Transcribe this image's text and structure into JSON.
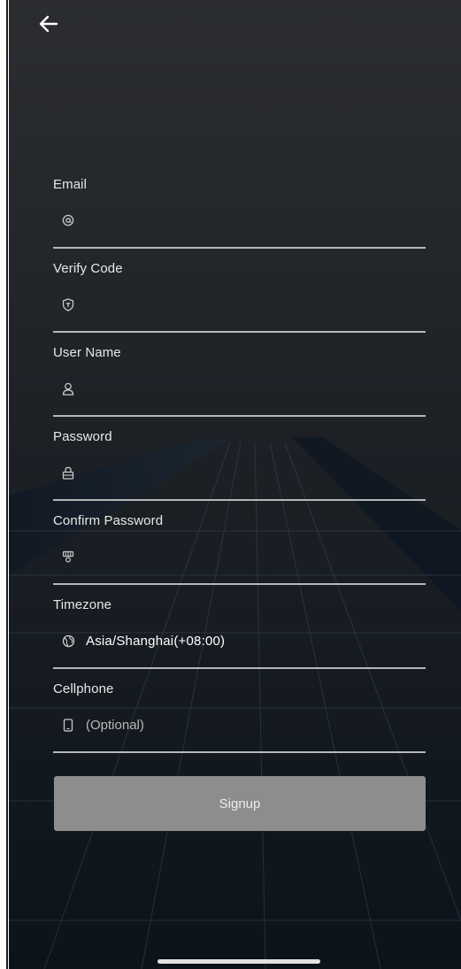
{
  "header": {
    "back_icon": "arrow-left-icon"
  },
  "form": {
    "fields": [
      {
        "label": "Email",
        "icon": "at-sign-icon",
        "value": "",
        "placeholder": ""
      },
      {
        "label": "Verify Code",
        "icon": "shield-icon",
        "value": "",
        "placeholder": ""
      },
      {
        "label": "User Name",
        "icon": "user-icon",
        "value": "",
        "placeholder": ""
      },
      {
        "label": "Password",
        "icon": "lock-icon",
        "value": "",
        "placeholder": ""
      },
      {
        "label": "Confirm Password",
        "icon": "key-icon",
        "value": "",
        "placeholder": ""
      },
      {
        "label": "Timezone",
        "icon": "globe-icon",
        "value": "Asia/Shanghai(+08:00)"
      },
      {
        "label": "Cellphone",
        "icon": "phone-icon",
        "value": "",
        "placeholder": "(Optional)"
      }
    ],
    "submit_label": "Signup"
  },
  "colors": {
    "background": "#1c1f24",
    "text": "#ffffff",
    "underline": "#b4b6b8",
    "button": "#8d8d8d"
  }
}
